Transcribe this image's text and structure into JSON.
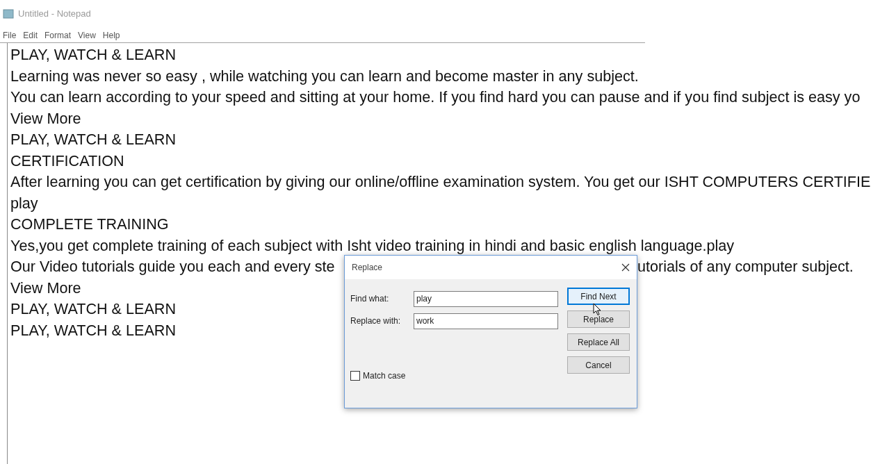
{
  "window": {
    "title": "Untitled - Notepad"
  },
  "menu": [
    "File",
    "Edit",
    "Format",
    "View",
    "Help"
  ],
  "lines": [
    {
      "text": "PLAY, WATCH & LEARN"
    },
    {
      "text": "Learning was never so easy , while watching you can learn and become master in any subject."
    },
    {
      "text": "You can learn according to your speed and sitting at your home. If you find hard you can pause and if you find subject is easy yo"
    },
    {
      "text": "View More"
    },
    {
      "text": "PLAY, WATCH & LEARN"
    },
    {
      "text": "CERTIFICATION"
    },
    {
      "text": "After learning you can get certification by giving our online/offline examination system. You get our ISHT COMPUTERS CERTIFIE"
    },
    {
      "text": "play"
    },
    {
      "text": "COMPLETE TRAINING"
    },
    {
      "text": "Yes,you get complete training of each subject with Isht video training in hindi and basic english language.play"
    },
    {
      "text": "Our Video tutorials guide you each and every ste",
      "text_after": "utorials of any computer subject."
    },
    {
      "text": "View More"
    },
    {
      "text": "PLAY, WATCH & LEARN"
    },
    {
      "text": "PLAY, WATCH & LEARN"
    }
  ],
  "dialog": {
    "title": "Replace",
    "fields": [
      {
        "label": "Find what:",
        "value": "play"
      },
      {
        "label": "Replace with:",
        "value": "work"
      }
    ],
    "match_case": {
      "label": "Match case",
      "checked": false
    },
    "buttons": [
      {
        "label": "Find Next",
        "focused": true
      },
      {
        "label": "Replace",
        "focused": false
      },
      {
        "label": "Replace All",
        "focused": false
      },
      {
        "label": "Cancel",
        "focused": false
      }
    ]
  }
}
